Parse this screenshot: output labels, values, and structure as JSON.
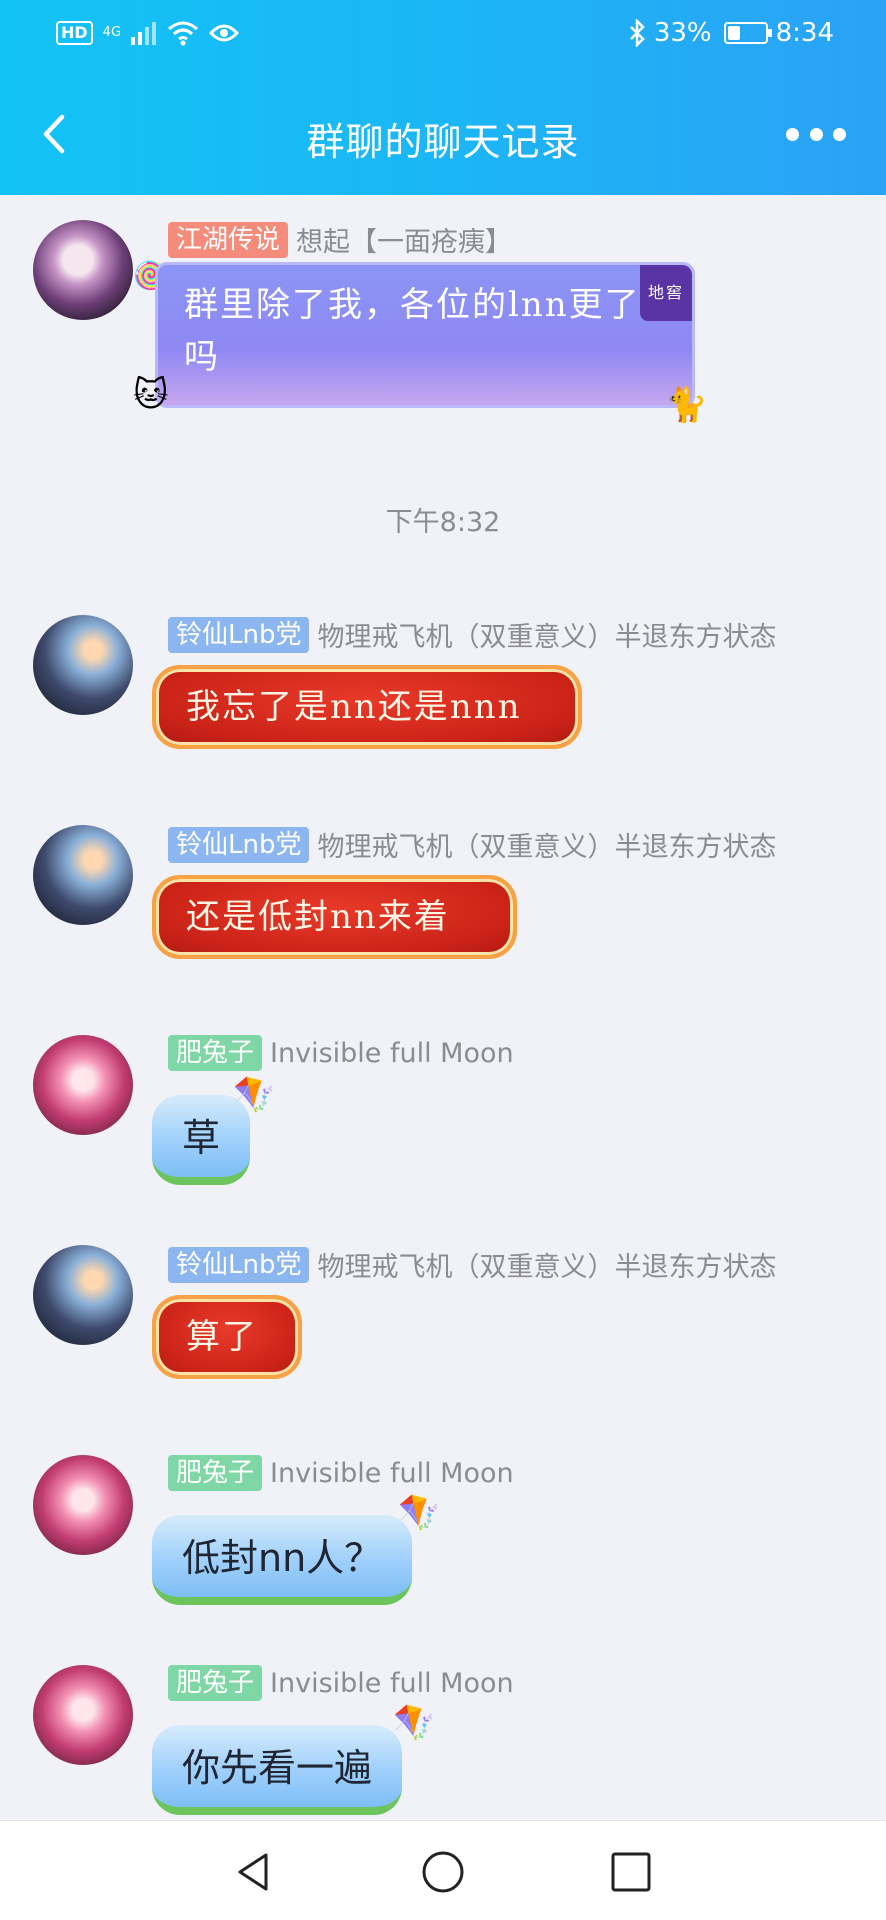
{
  "status_bar": {
    "left_hd": "HD",
    "left_net": "4G",
    "right_battery_text": "33%",
    "battery_level_fraction": 0.33,
    "time": "8:34"
  },
  "header": {
    "title": "群聊的聊天记录"
  },
  "messages": [
    {
      "badge": "江湖传说",
      "badge_color": "#f58b7a",
      "name": "想起【一面疮痍】",
      "text": "群里除了我，各位的lnn更了吗",
      "corner_tag": "地窖"
    },
    {
      "badge": "铃仙Lnb党",
      "badge_color": "#8cb6ef",
      "name": "物理戒飞机（双重意义）半退东方状态",
      "text": "我忘了是nn还是nnn"
    },
    {
      "badge": "铃仙Lnb党",
      "badge_color": "#8cb6ef",
      "name": "物理戒飞机（双重意义）半退东方状态",
      "text": "还是低封nn来着"
    },
    {
      "badge": "肥兔子",
      "badge_color": "#7ed7a4",
      "name": "Invisible full Moon",
      "text": "草"
    },
    {
      "badge": "铃仙Lnb党",
      "badge_color": "#8cb6ef",
      "name": "物理戒飞机（双重意义）半退东方状态",
      "text": "算了"
    },
    {
      "badge": "肥兔子",
      "badge_color": "#7ed7a4",
      "name": "Invisible full Moon",
      "text": "低封nn人？"
    },
    {
      "badge": "肥兔子",
      "badge_color": "#7ed7a4",
      "name": "Invisible full Moon",
      "text": "你先看一遍"
    }
  ],
  "timestamp": "下午8:32",
  "colors": {
    "header_gradient_start": "#13c3f6",
    "header_gradient_end": "#2ba2f5",
    "background": "#f1f2f7"
  },
  "icons": [
    "back-arrow-icon",
    "more-dots-icon",
    "nav-back-icon",
    "nav-home-icon",
    "nav-recent-icon"
  ]
}
